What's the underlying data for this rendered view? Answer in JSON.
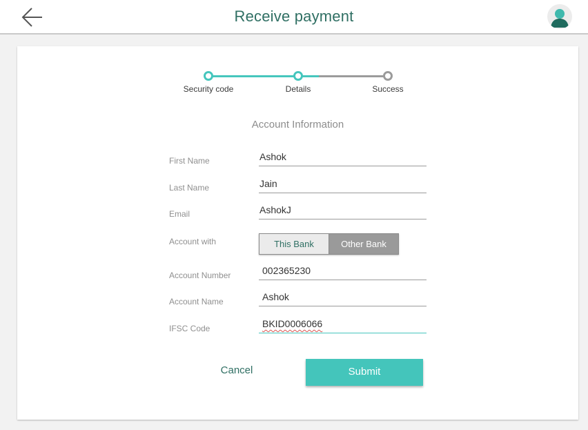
{
  "header": {
    "title": "Receive payment",
    "back_icon": "arrow-left-icon",
    "avatar_icon": "user-avatar-icon"
  },
  "stepper": {
    "steps": [
      {
        "label": "Security code",
        "state": "done"
      },
      {
        "label": "Details",
        "state": "current"
      },
      {
        "label": "Success",
        "state": "todo"
      }
    ]
  },
  "form": {
    "section_title": "Account Information",
    "first_name": {
      "label": "First Name",
      "value": "Ashok"
    },
    "last_name": {
      "label": "Last Name",
      "value": "Jain"
    },
    "email": {
      "label": "Email",
      "value": "AshokJ"
    },
    "account_with": {
      "label": "Account with",
      "options": [
        "This Bank",
        "Other Bank"
      ],
      "selected": "Other Bank"
    },
    "account_number": {
      "label": "Account Number",
      "value": "002365230"
    },
    "account_name": {
      "label": "Account Name",
      "value": "Ashok"
    },
    "ifsc_code": {
      "label": "IFSC Code",
      "value": "BKID0006066"
    }
  },
  "actions": {
    "cancel_label": "Cancel",
    "submit_label": "Submit"
  },
  "colors": {
    "accent": "#45c6bd",
    "title": "#2f6f63",
    "inactive": "#9b9b9b"
  }
}
